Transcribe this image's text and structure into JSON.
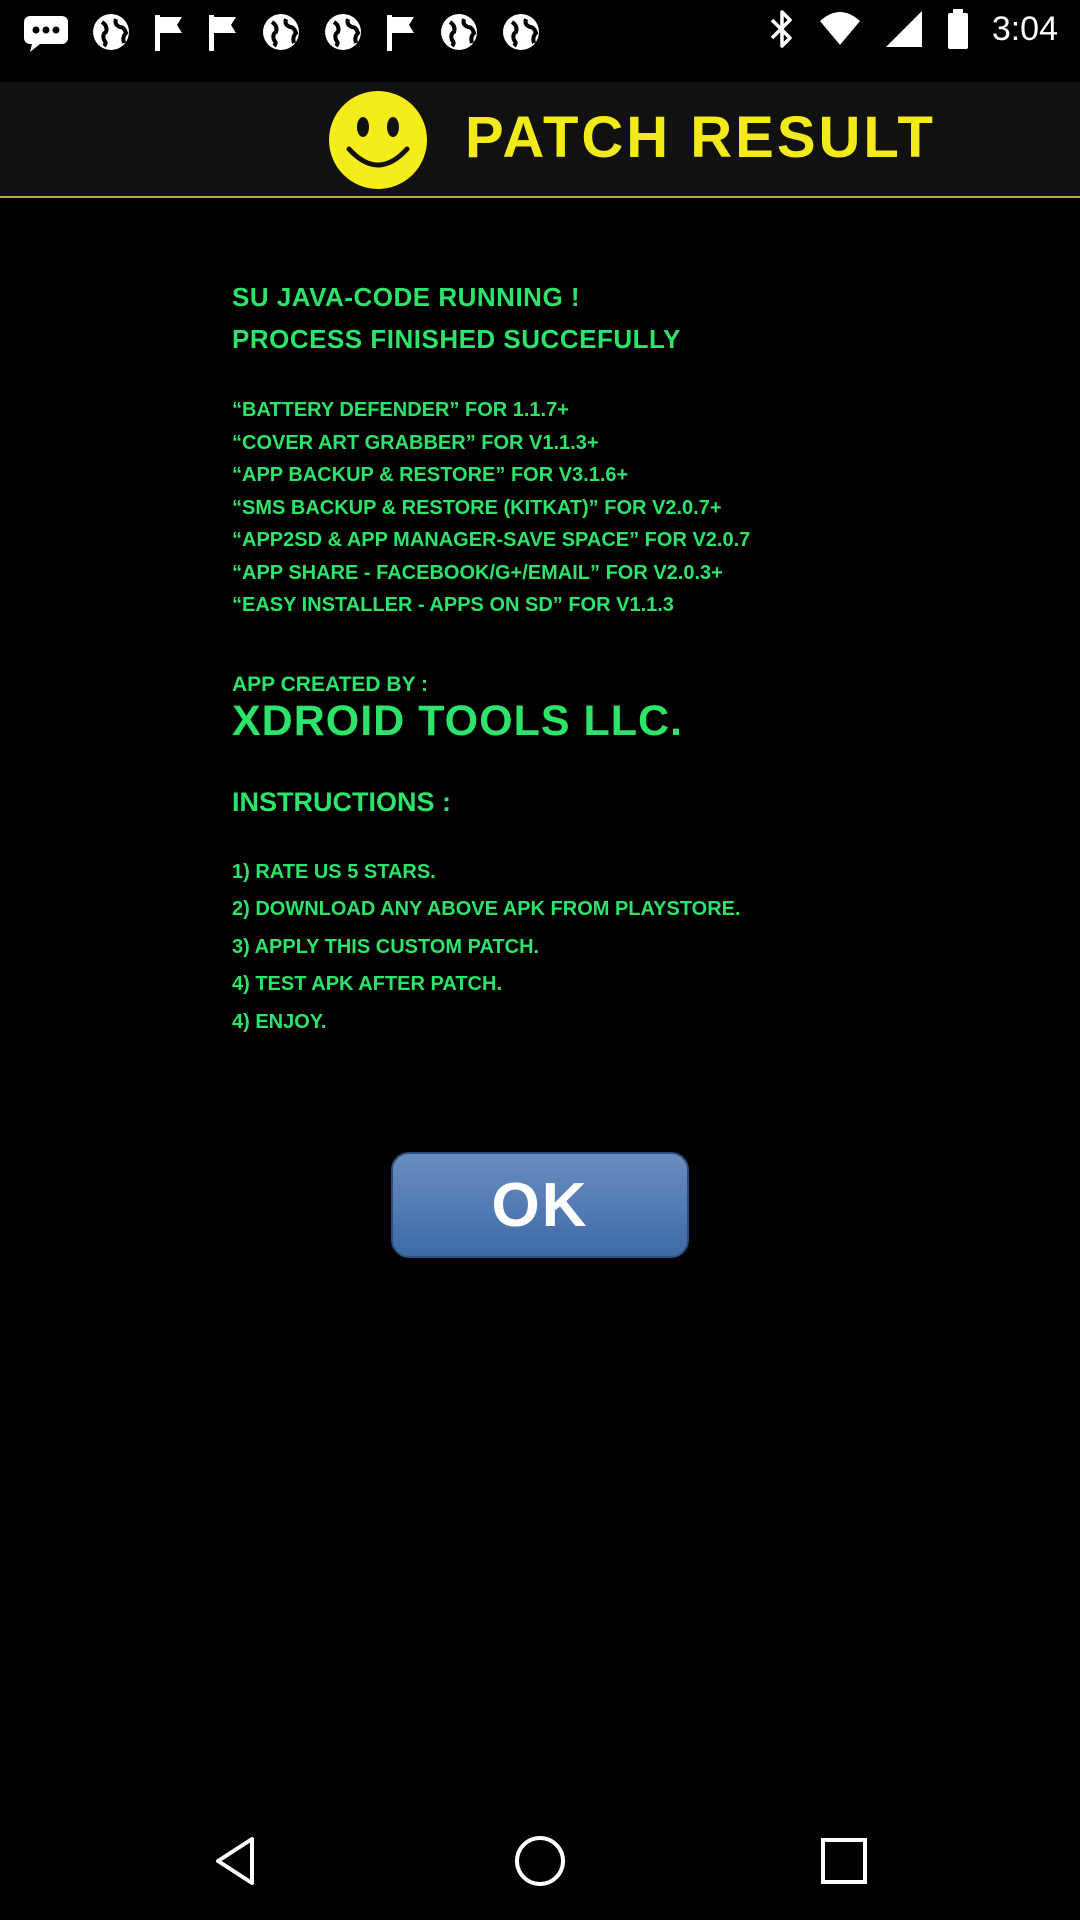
{
  "status_bar": {
    "time": "3:04",
    "notification_icons": [
      "messaging-icon",
      "globe-icon",
      "flag-icon",
      "flag-icon",
      "globe-icon",
      "globe-icon",
      "flag-icon",
      "globe-icon",
      "globe-icon"
    ],
    "right_icons": [
      "bluetooth-icon",
      "wifi-icon",
      "signal-icon",
      "battery-icon"
    ]
  },
  "header": {
    "title": "PATCH RESULT",
    "icon": "smiley-icon",
    "title_color": "#f2ea1b"
  },
  "content": {
    "status_lines": [
      "SU JAVA-CODE RUNNING !",
      "PROCESS FINISHED SUCCEFULLY"
    ],
    "app_list": [
      "“BATTERY DEFENDER” FOR 1.1.7+",
      "“COVER ART GRABBER” FOR V1.1.3+",
      "“APP BACKUP & RESTORE” FOR V3.1.6+",
      "“SMS BACKUP & RESTORE (KITKAT)” FOR V2.0.7+",
      "“APP2SD & APP MANAGER-SAVE SPACE” FOR V2.0.7",
      "“APP SHARE - FACEBOOK/G+/EMAIL” FOR V2.0.3+",
      "“EASY INSTALLER - APPS ON SD” FOR V1.1.3"
    ],
    "creator_label": "APP CREATED BY :",
    "creator_name": "XDROID TOOLS LLC.",
    "instructions_title": "INSTRUCTIONS :",
    "instructions": [
      "1) RATE US 5 STARS.",
      "2) DOWNLOAD ANY ABOVE APK FROM PLAYSTORE.",
      "3) APPLY THIS CUSTOM PATCH.",
      "4) TEST APK AFTER PATCH.",
      "4) ENJOY."
    ],
    "text_color": "#2ee36a"
  },
  "ok_button": {
    "label": "OK",
    "color": "#4d76b2"
  },
  "nav_bar": {
    "buttons": [
      "back-icon",
      "home-icon",
      "recents-icon"
    ]
  }
}
